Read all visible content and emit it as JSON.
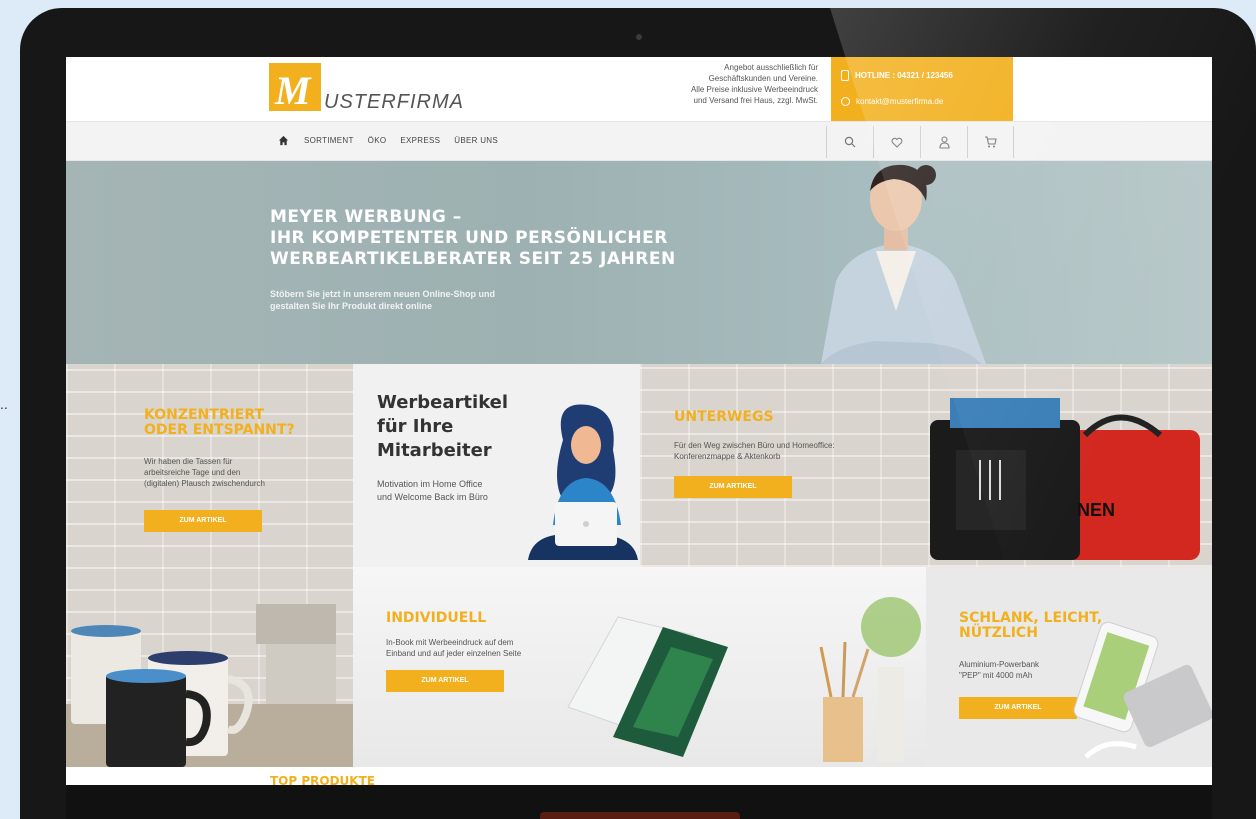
{
  "header": {
    "logo_letter": "M",
    "logo_text": "USTERFIRMA",
    "offer_lines": [
      "Angebot ausschließlich für",
      "Geschäftskunden und Vereine.",
      "Alle Preise inklusive Werbeeindruck",
      "und Versand frei Haus, zzgl. MwSt."
    ],
    "hotline": "HOTLINE : 04321 / 123456",
    "email": "kontakt@musterfirma.de"
  },
  "nav": {
    "items": [
      "SORTIMENT",
      "ÖKO",
      "EXPRESS",
      "ÜBER UNS"
    ],
    "icons": [
      "search-icon",
      "heart-icon",
      "user-icon",
      "cart-icon"
    ]
  },
  "hero": {
    "lines": [
      "MEYER WERBUNG –",
      "IHR KOMPETENTER UND PERSÖNLICHER",
      "WERBEARTIKELBERATER SEIT 25 JAHREN"
    ],
    "sub_lines": [
      "Stöbern Sie jetzt in unserem neuen Online-Shop und",
      "gestalten Sie Ihr Produkt direkt online"
    ]
  },
  "tiles": {
    "konzentriert": {
      "title_lines": [
        "KONZENTRIERT",
        "ODER ENTSPANNT?"
      ],
      "desc_lines": [
        "Wir haben die Tassen für",
        "arbeitsreiche Tage und den",
        "(digitalen) Plausch zwischendurch"
      ],
      "button": "ZUM ARTIKEL"
    },
    "werbeartikel": {
      "title_lines": [
        "Werbeartikel",
        "für Ihre",
        "Mitarbeiter"
      ],
      "desc_lines": [
        "Motivation im Home Office",
        "und Welcome Back im Büro"
      ]
    },
    "unterwegs": {
      "title": "UNTERWEGS",
      "desc_lines": [
        "Für den Weg zwischen Büro und Homeoffice:",
        "Konferenzmappe & Aktenkorb"
      ],
      "button": "ZUM ARTIKEL",
      "bag_print": "NEN"
    },
    "individuell": {
      "title": "INDIVIDUELL",
      "desc_lines": [
        "In-Book mit Werbeeindruck auf dem",
        "Einband und auf jeder einzelnen Seite"
      ],
      "button": "ZUM ARTIKEL"
    },
    "schlank": {
      "title_lines": [
        "SCHLANK, LEICHT,",
        "NÜTZLICH"
      ],
      "desc_lines": [
        "Aluminium-Powerbank",
        "\"PEP\" mit 4000 mAh"
      ],
      "button": "ZUM ARTIKEL"
    }
  },
  "footer_peek": "TOP PRODUKTE",
  "page_edge": "..",
  "colors": {
    "accent": "#f2b01e",
    "frame": "#171717",
    "background": "#dcebf7"
  }
}
